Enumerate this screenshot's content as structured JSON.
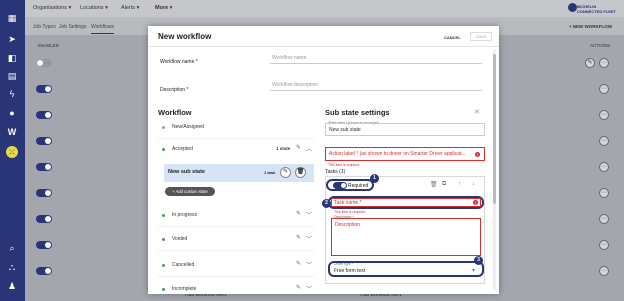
{
  "topnav": {
    "organisations": "Organisations ▾",
    "locations": "Locations ▾",
    "alerts": "Alerts ▾",
    "more": "More ▾",
    "brand_line1": "MICHELIN",
    "brand_line2": "CONNECTED FLEET"
  },
  "subtabs": {
    "job_types": "Job Types",
    "job_settings": "Job Settings",
    "workflows": "Workflows",
    "new_workflow": "+ NEW WORKFLOW"
  },
  "list": {
    "col_enabled": "ENABLED",
    "col_actions": "ACTIONS",
    "bottom_item_1": "Hub workflow live1",
    "bottom_item_2": "Hub workflow live1"
  },
  "modal": {
    "title": "New workflow",
    "cancel": "CANCEL",
    "save": "SAVE",
    "workflow_name_label": "Workflow name *",
    "workflow_name_placeholder": "Workflow name",
    "description_label": "Description *",
    "description_placeholder": "Workflow description",
    "workflow_section": "Workflow",
    "states": [
      {
        "label": "New/Assigned",
        "count": "",
        "color": "#9e9e9e"
      },
      {
        "label": "Accepted",
        "count": "1 state",
        "color": "#43a047"
      },
      {
        "label": "In progress",
        "count": "",
        "color": "#43a047"
      },
      {
        "label": "Voided",
        "count": "",
        "color": "#43a047"
      },
      {
        "label": "Cancelled",
        "count": "",
        "color": "#43a047"
      },
      {
        "label": "Incomplete",
        "count": "",
        "color": "#43a047"
      }
    ],
    "substate": {
      "label": "New sub state",
      "count": "1 task"
    },
    "add_custom_state": "+ Add custom state",
    "sub_state_settings": {
      "title": "Sub state settings",
      "state_name_label": "State label * (shown to manager)",
      "state_name_value": "New sub state",
      "action_label_placeholder": "Action label * (as shown to driver on Smarter Driver applicat...",
      "action_label_error": "This field is required",
      "tasks_label": "Tasks (1)",
      "required_label": "Required",
      "task_name_placeholder": "Task name *",
      "task_name_error": "This field is required",
      "description_small": "Description *",
      "description_placeholder": "Description",
      "driver_type_label": "Driver type *",
      "driver_type_value": "Free form text",
      "badges": [
        "1",
        "2",
        "3"
      ]
    }
  },
  "colors": {
    "sidebar": "#2a3577",
    "accent": "#2a3577",
    "error": "#d32f2f",
    "highlight_row": "#d6e4f5"
  }
}
